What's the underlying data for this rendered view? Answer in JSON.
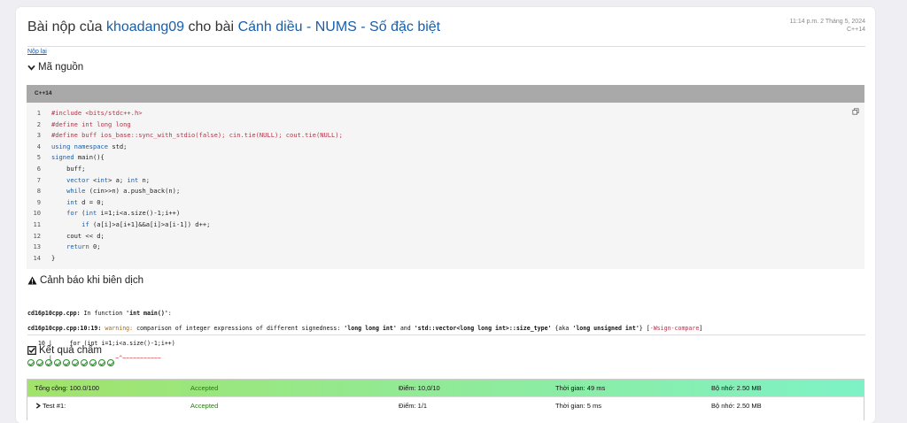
{
  "header": {
    "title_prefix": "Bài nộp của",
    "user": "khoadang09",
    "title_mid": "cho bài",
    "problem": "Cánh diều - NUMS - Số đặc biệt",
    "timestamp": "11:14 p.m. 2 Tháng 5, 2024",
    "language": "C++14"
  },
  "resubmit_label": "Nộp lại",
  "source": {
    "heading": "Mã nguồn",
    "lang_label": "C++14",
    "lines": [
      "#include <bits/stdc++.h>",
      "#define int long long",
      "#define buff ios_base::sync_with_stdio(false); cin.tie(NULL); cout.tie(NULL);",
      "using namespace std;",
      "signed main(){",
      "    buff;",
      "    vector <int> a; int n;",
      "    while (cin>>n) a.push_back(n);",
      "    int d = 0;",
      "    for (int i=1;i<a.size()-1;i++)",
      "        if (a[i]>a[i+1]&&a[i]>a[i-1]) d++;",
      "    cout << d;",
      "    return 0;",
      "}"
    ]
  },
  "compile": {
    "heading": "Cảnh báo khi biên dịch",
    "line1_file": "cd16p10cpp.cpp:",
    "line1_text": " In function ",
    "line1_func": "'int main()'",
    "line1_end": ":",
    "line2_loc": "cd16p10cpp.cpp:10:19:",
    "line2_warn": " warning:",
    "line2_a": " comparison of integer expressions of different signedness: ",
    "line2_t1": "'long long int'",
    "line2_b": " and ",
    "line2_t2": "'std::vector<long long int>::size_type'",
    "line2_c": " {aka ",
    "line2_t3": "'long unsigned int'",
    "line2_d": "} [",
    "line2_flag": "-Wsign-compare",
    "line2_e": "]",
    "line3_num": "   10 |",
    "line3_code": "     for (int i=1;i<a.size()-1;i++)",
    "line4_bar": "      |",
    "line4_caret": "                  ~^~~~~~~~~~~~"
  },
  "results": {
    "heading": "Kết quả chấm",
    "passed_cases": 10,
    "total_row": {
      "label": "Tổng cộng: 100.0/100",
      "status": "Accepted",
      "points": "Điểm: 10,0/10",
      "time": "Thời gian: 49 ms",
      "memory": "Bộ nhớ: 2.50 MB"
    },
    "test_rows": [
      {
        "label": "Test #1:",
        "status": "Accepted",
        "points": "Điểm: 1/1",
        "time": "Thời gian: 5 ms",
        "memory": "Bộ nhớ: 2.50 MB"
      }
    ]
  },
  "colors": {
    "link": "#1b5ea8",
    "accepted": "#237a0f",
    "total_grad_start": "#a2e36a",
    "total_grad_end": "#7ef2c6"
  },
  "icons": {
    "source_toggle": "chevron-down-icon",
    "compile": "warning-triangle-icon",
    "results": "checkbox-checked-icon",
    "copy": "copy-icon",
    "case": "check-circle-icon",
    "test_expand": "chevron-right-icon"
  }
}
